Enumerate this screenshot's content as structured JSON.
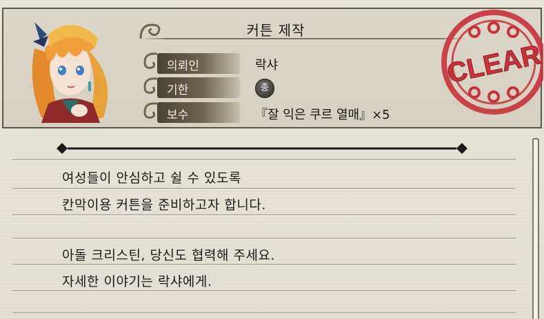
{
  "quest": {
    "title": "커튼 제작",
    "requester_label": "의뢰인",
    "requester": "락샤",
    "deadline_label": "기한",
    "deadline_grade": "종",
    "reward_label": "보수",
    "reward": "『잘 익은 쿠르 열매』×5",
    "stamp_text": "CLEAR"
  },
  "description": {
    "lines": [
      "여성들이 안심하고 쉴 수 있도록",
      "칸막이용 커튼을 준비하고자 합니다.",
      "아돌 크리스틴, 당신도 협력해 주세요.",
      "자세한 이야기는 락샤에게."
    ]
  },
  "colors": {
    "stamp_red": "#c8323a",
    "label_bg": "#5a5242",
    "paper": "#e6e2d6"
  }
}
